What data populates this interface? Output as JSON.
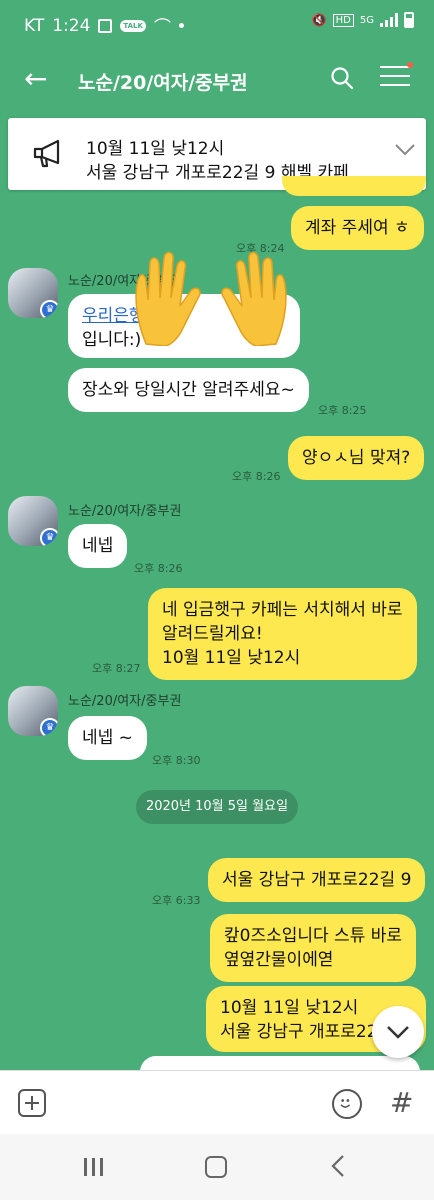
{
  "status_bar": {
    "carrier": "KT",
    "time": "1:24",
    "network": "5G"
  },
  "header": {
    "title": "노순/20/여자/중부권",
    "back_icon": "back-arrow-icon",
    "search_icon": "search-icon",
    "menu_icon": "menu-icon"
  },
  "notice": {
    "line1": "10월 11일 낮12시",
    "line2": "서울 강남구 개포로22길 9 해벨 카페"
  },
  "messages": {
    "m1": {
      "text": "계좌 주세여 ㅎ",
      "time": "오후 8:24"
    },
    "sender_name": "노순/20/여자/중부권",
    "m2_line1": "우리은행",
    "m2_line1_trail": "1",
    "m2_line2": "입니다:)",
    "m3": {
      "text": "장소와 당일시간 알려주세요~",
      "time": "오후 8:25"
    },
    "m4": {
      "text": "양ㅇㅅ님 맞져?",
      "time": "오후 8:26"
    },
    "m5": {
      "text": "네넵",
      "time": "오후 8:26"
    },
    "m6": {
      "line1": "네 입금햇구 카페는 서치해서 바로",
      "line2": "알려드릴게요!",
      "line3": "10월 11일 낮12시",
      "time": "오후 8:27"
    },
    "m7": {
      "text": "네넵 ~",
      "time": "오후 8:30"
    },
    "date_divider": "2020년 10월 5일 월요일",
    "m8": {
      "text": "서울 강남구 개포로22길 9",
      "time": "오후 6:33"
    },
    "m9": {
      "line1": "캎0즈소입니다 스튜 바로",
      "line2": "옆옆간물이에엳"
    },
    "m10": {
      "line1": "10월 11일 낮12시",
      "line2": "서울 강남구 개포로22"
    }
  },
  "colors": {
    "background": "#4aae78",
    "bubble_mine": "#fee84f",
    "bubble_other": "#ffffff"
  }
}
